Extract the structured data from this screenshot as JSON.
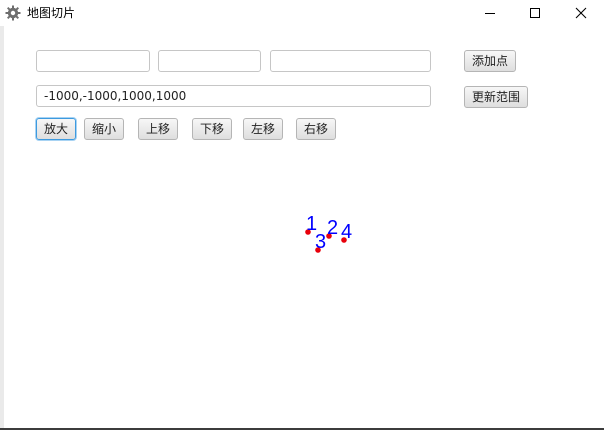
{
  "window": {
    "title": "地图切片",
    "icon": "gear-icon",
    "controls": [
      "minimize-icon",
      "maximize-icon",
      "close-icon"
    ]
  },
  "inputs": {
    "field1": {
      "value": "",
      "placeholder": ""
    },
    "field2": {
      "value": "",
      "placeholder": ""
    },
    "field3": {
      "value": "",
      "placeholder": ""
    },
    "range": {
      "value": "-1000,-1000,1000,1000",
      "placeholder": ""
    }
  },
  "buttons": {
    "add_point": "添加点",
    "update_range": "更新范围",
    "zoom_in": "放大",
    "zoom_out": "缩小",
    "move_up": "上移",
    "move_down": "下移",
    "move_left": "左移",
    "move_right": "右移"
  },
  "map": {
    "point_color": "#e8000b",
    "label_color": "#0000ff",
    "points": [
      {
        "label": "1"
      },
      {
        "label": "2"
      },
      {
        "label": "3"
      },
      {
        "label": "4"
      }
    ]
  },
  "colors": {
    "focus_border": "#3d9adf"
  }
}
